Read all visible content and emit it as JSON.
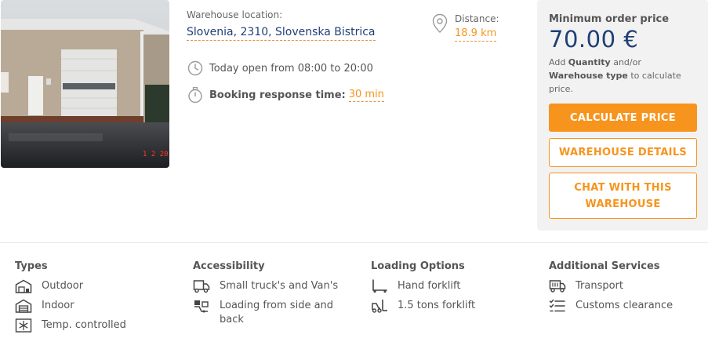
{
  "location": {
    "label": "Warehouse location:",
    "value": "Slovenia, 2310, Slovenska Bistrica"
  },
  "distance": {
    "label": "Distance:",
    "value": "18.9 km"
  },
  "hours": {
    "text": "Today open from 08:00 to 20:00"
  },
  "booking": {
    "label": "Booking response time:",
    "value": "30 min"
  },
  "photo": {
    "date_stamp": "1 2 20"
  },
  "pricing": {
    "label": "Minimum order price",
    "value": "70.00 €",
    "hint_prefix": "Add ",
    "hint_quantity": "Quantity",
    "hint_mid": " and/or ",
    "hint_type": "Warehouse type",
    "hint_suffix": " to calculate price."
  },
  "buttons": {
    "calculate": "CALCULATE PRICE",
    "details": "WAREHOUSE DETAILS",
    "chat": "CHAT WITH THIS WAREHOUSE"
  },
  "features": {
    "types": {
      "title": "Types",
      "items": [
        {
          "label": "Outdoor",
          "icon": "outdoor-warehouse-icon"
        },
        {
          "label": "Indoor",
          "icon": "indoor-warehouse-icon"
        },
        {
          "label": "Temp. controlled",
          "icon": "snowflake-icon"
        }
      ]
    },
    "accessibility": {
      "title": "Accessibility",
      "items": [
        {
          "label": "Small truck's and Van's",
          "icon": "truck-icon"
        },
        {
          "label": "Loading from side and back",
          "icon": "loading-dock-icon"
        }
      ]
    },
    "loading": {
      "title": "Loading Options",
      "items": [
        {
          "label": "Hand forklift",
          "icon": "hand-forklift-icon"
        },
        {
          "label": "1.5 tons forklift",
          "icon": "forklift-icon"
        }
      ]
    },
    "services": {
      "title": "Additional Services",
      "items": [
        {
          "label": "Transport",
          "icon": "transport-truck-icon"
        },
        {
          "label": "Customs clearance",
          "icon": "checklist-icon"
        }
      ]
    }
  },
  "colors": {
    "accent": "#f7941d",
    "brand_blue": "#1f3f75",
    "panel_bg": "#f2f2f2"
  }
}
